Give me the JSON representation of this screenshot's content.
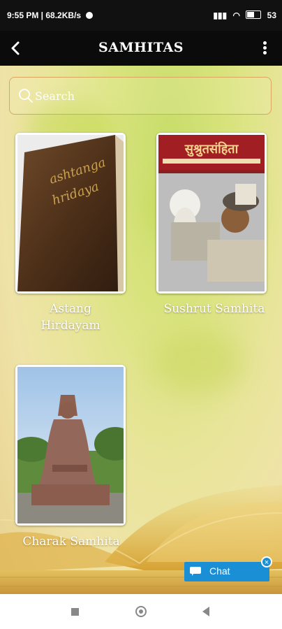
{
  "status": {
    "time_speed": "9:55 PM | 68.2KB/s",
    "battery": "53"
  },
  "header": {
    "title": "SAMHITAS"
  },
  "search": {
    "placeholder": "Search"
  },
  "items": [
    {
      "label": "Astang Hirdayam",
      "cover_text": "Ashtanga Hridaya"
    },
    {
      "label": "Sushrut Samhita",
      "cover_text": "सुश्रुतसंहिता"
    },
    {
      "label": "Charak Samhita"
    }
  ],
  "chat": {
    "label": "Chat"
  },
  "colors": {
    "app_bar": "#0b0b0b",
    "accent_border": "#d8a660",
    "chat": "#1a8fd6"
  }
}
